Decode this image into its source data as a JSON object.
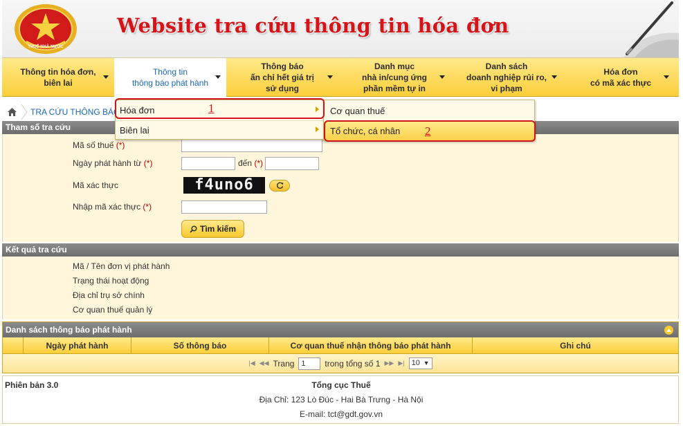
{
  "header": {
    "site_title": "Website tra cứu thông tin hóa đơn",
    "emblem_text": "THUẾ NHÀ NƯỚC"
  },
  "menu": [
    {
      "line1": "Thông tin hóa đơn,",
      "line2": "biên lai",
      "line3": ""
    },
    {
      "line1": "Thông tin",
      "line2": "thông báo phát hành",
      "line3": ""
    },
    {
      "line1": "Thông báo",
      "line2": "ấn chỉ hết giá trị",
      "line3": "sử dụng"
    },
    {
      "line1": "Danh mục",
      "line2": "nhà in/cung ứng",
      "line3": "phần mềm tự in"
    },
    {
      "line1": "Danh sách",
      "line2": "doanh nghiệp rủi ro,",
      "line3": "vi phạm"
    },
    {
      "line1": "Hóa đơn",
      "line2": "có mã xác thực",
      "line3": ""
    }
  ],
  "breadcrumb": {
    "current": "TRA CỨU THÔNG BÁO"
  },
  "search": {
    "section_title": "Tham số tra cứu",
    "tax_code_label": "Mã số thuế",
    "issue_date_label": "Ngày phát hành từ",
    "to_label": "đến",
    "captcha_label": "Mã xác thực",
    "captcha_text": "f4uno6",
    "captcha_input_label": "Nhập mã xác thực",
    "required_mark": "(*)",
    "search_button": "Tìm kiếm"
  },
  "result": {
    "section_title": "Kết quả tra cứu",
    "fields": [
      "Mã / Tên đơn vị phát hành",
      "Trạng thái hoạt động",
      "Địa chỉ trụ sở chính",
      "Cơ quan thuế quản lý"
    ]
  },
  "list": {
    "title": "Danh sách thông báo phát hành",
    "columns": [
      "Ngày phát hành",
      "Số thông báo",
      "Cơ quan thuế nhận thông báo phát hành",
      "Ghi chú"
    ],
    "pager_page_label": "Trang",
    "pager_page_value": "1",
    "pager_total_label": "trong tổng số 1",
    "pager_size": "10"
  },
  "footer": {
    "version": "Phiên bản 3.0",
    "org": "Tổng cục Thuế",
    "address": "Địa Chỉ: 123 Lò Đúc - Hai Bà Trưng - Hà Nội",
    "email": "E-mail: tct@gdt.gov.vn"
  },
  "submenu": {
    "level1": [
      "Hóa đơn",
      "Biên lai"
    ],
    "level2": [
      "Cơ quan thuế",
      "Tổ chức, cá nhân"
    ]
  },
  "annotations": {
    "step1": "1",
    "step2": "2",
    "color": "#d0121a"
  },
  "colors": {
    "menu_gold": "#fccf3a",
    "section_gray": "#7a7a7a",
    "link_blue": "#1a66b5",
    "title_red": "#d5141a"
  }
}
